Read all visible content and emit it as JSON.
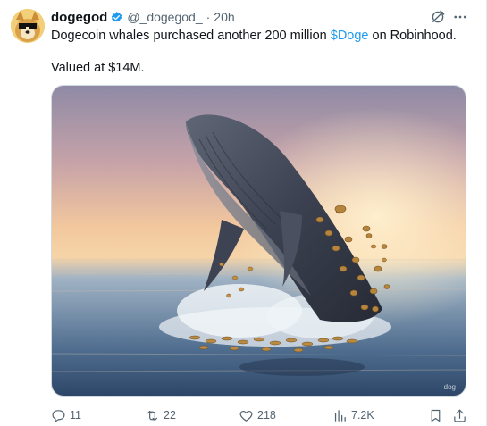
{
  "post": {
    "author": {
      "display_name": "dogegod",
      "handle": "@_dogegod_",
      "separator": "·",
      "time": "20h",
      "verified": true
    },
    "text": {
      "before_cashtag": "Dogecoin whales purchased another 200 million ",
      "cashtag": "$Doge",
      "after_cashtag": " on Robinhood.",
      "second_paragraph": "Valued at $14M."
    },
    "media": {
      "alt": "whale-breaching-with-coins",
      "watermark": "dog"
    },
    "actions": {
      "replies": "11",
      "reposts": "22",
      "likes": "218",
      "views": "7.2K"
    }
  },
  "icons": {
    "verified": "verified-badge-icon",
    "grok": "grok-icon",
    "more": "more-icon",
    "reply": "reply-icon",
    "repost": "repost-icon",
    "like": "heart-icon",
    "views": "views-icon",
    "bookmark": "bookmark-icon",
    "share": "share-icon"
  },
  "colors": {
    "text_primary": "#0f1419",
    "text_secondary": "#536471",
    "accent": "#1d9bf0",
    "border": "#cfd9de"
  }
}
